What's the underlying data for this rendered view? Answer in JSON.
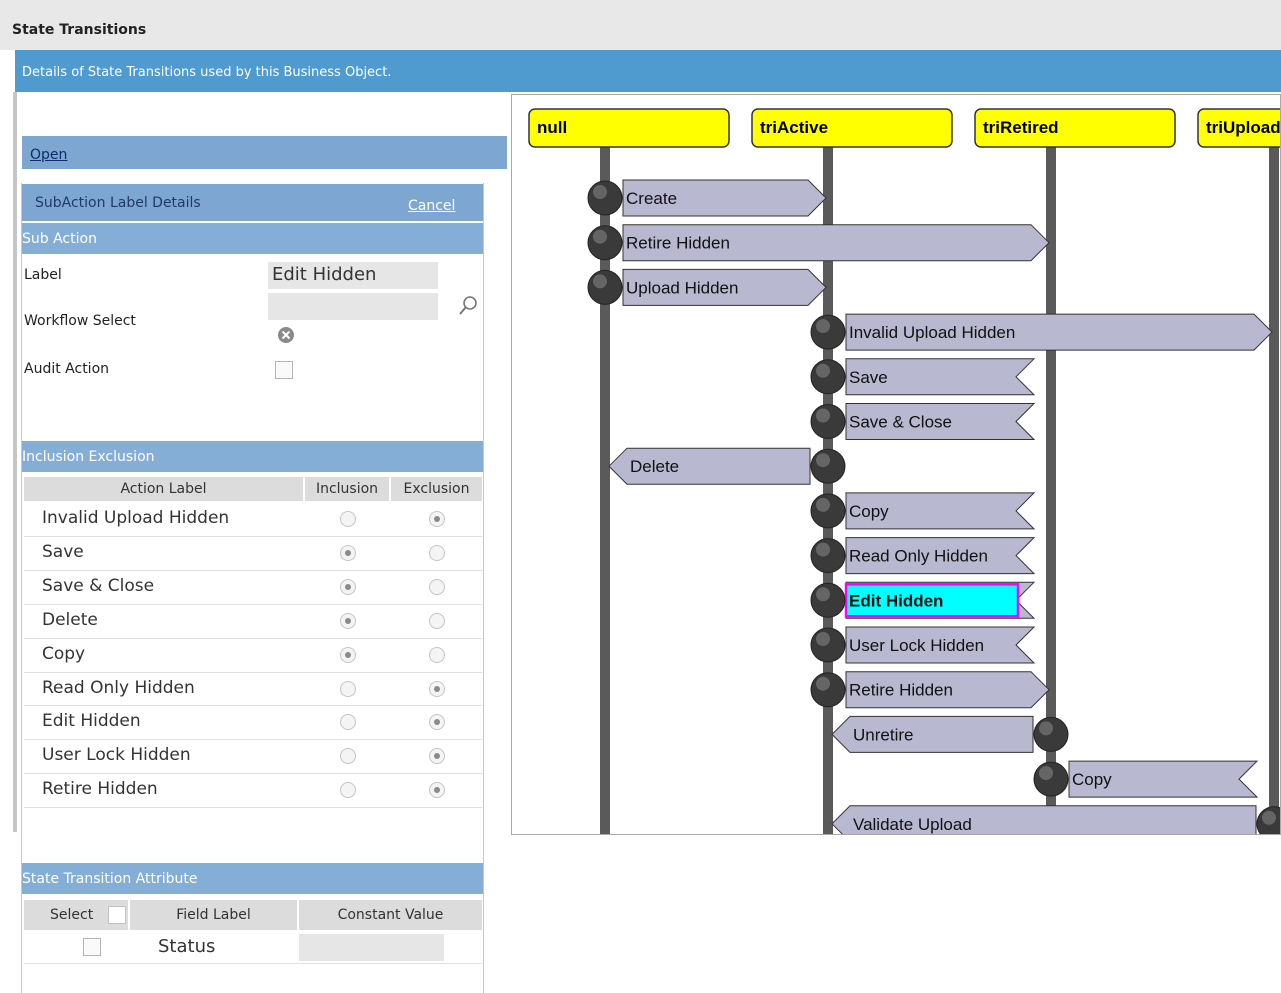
{
  "page": {
    "title": "State Transitions",
    "info": "Details of State Transitions used by this Business Object."
  },
  "open_bar": {
    "link": "Open"
  },
  "subaction": {
    "header": "SubAction Label Details",
    "cancel": "Cancel",
    "section": "Sub Action",
    "label_label": "Label",
    "label_value": "Edit Hidden",
    "workflow_label": "Workflow Select",
    "workflow_value": "",
    "audit_label": "Audit Action",
    "audit_checked": false
  },
  "inclusion": {
    "section": "Inclusion Exclusion",
    "columns": [
      "Action Label",
      "Inclusion",
      "Exclusion"
    ],
    "rows": [
      {
        "label": "Invalid Upload Hidden",
        "selected": "Exclusion"
      },
      {
        "label": "Save",
        "selected": "Inclusion"
      },
      {
        "label": "Save & Close",
        "selected": "Inclusion"
      },
      {
        "label": "Delete",
        "selected": "Inclusion"
      },
      {
        "label": "Copy",
        "selected": "Inclusion"
      },
      {
        "label": "Read Only Hidden",
        "selected": "Exclusion"
      },
      {
        "label": "Edit Hidden",
        "selected": "Exclusion"
      },
      {
        "label": "User Lock Hidden",
        "selected": "Exclusion"
      },
      {
        "label": "Retire Hidden",
        "selected": "Exclusion"
      }
    ]
  },
  "state_transition_attr": {
    "section": "State Transition Attribute",
    "columns": [
      "Select",
      "Field Label",
      "Constant Value"
    ],
    "rows": [
      {
        "checked": false,
        "field_label": "Status",
        "constant_value": ""
      }
    ]
  },
  "diagram": {
    "states": [
      "null",
      "triActive",
      "triRetired",
      "triUpload"
    ],
    "transitions": [
      {
        "label": "Create",
        "from": "null",
        "to": "triActive",
        "highlighted": false
      },
      {
        "label": "Retire Hidden",
        "from": "null",
        "to": "triRetired",
        "highlighted": false
      },
      {
        "label": "Upload Hidden",
        "from": "null",
        "to": "triActive",
        "highlighted": false
      },
      {
        "label": "Invalid Upload Hidden",
        "from": "triActive",
        "to": "triUpload",
        "highlighted": false
      },
      {
        "label": "Save",
        "from": "triActive",
        "to": "triActive",
        "highlighted": false
      },
      {
        "label": "Save & Close",
        "from": "triActive",
        "to": "triActive",
        "highlighted": false
      },
      {
        "label": "Delete",
        "from": "triActive",
        "to": "null",
        "highlighted": false
      },
      {
        "label": "Copy",
        "from": "triActive",
        "to": "triActive",
        "highlighted": false
      },
      {
        "label": "Read Only Hidden",
        "from": "triActive",
        "to": "triActive",
        "highlighted": false
      },
      {
        "label": "Edit Hidden",
        "from": "triActive",
        "to": "triActive",
        "highlighted": true
      },
      {
        "label": "User Lock Hidden",
        "from": "triActive",
        "to": "triActive",
        "highlighted": false
      },
      {
        "label": "Retire Hidden",
        "from": "triActive",
        "to": "triRetired",
        "highlighted": false
      },
      {
        "label": "Unretire",
        "from": "triRetired",
        "to": "triActive",
        "highlighted": false
      },
      {
        "label": "Copy",
        "from": "triRetired",
        "to": "triRetired",
        "highlighted": false
      },
      {
        "label": "Validate Upload",
        "from": "triUpload",
        "to": "triActive",
        "highlighted": false
      }
    ]
  },
  "colors": {
    "info_bar": "#4f9bd0",
    "section_header": "#85aed6",
    "state_box": "#ffff00",
    "transition_box": "#b8b8d0",
    "highlight_fill": "#00ffff",
    "highlight_border": "#ff00ff"
  }
}
